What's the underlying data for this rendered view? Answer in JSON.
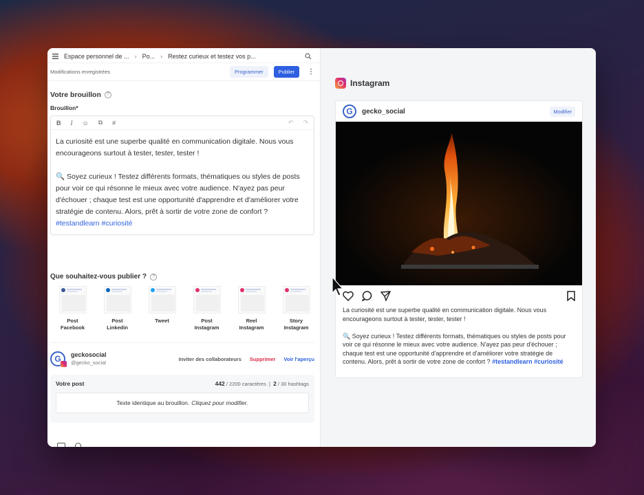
{
  "topbar": {
    "menu_icon": "hamburger-icon",
    "crumb1": "Espace personnel de ...",
    "crumb2": "Po...",
    "crumb3": "Restez curieux et testez vos p...",
    "search_icon": "search-icon"
  },
  "status": {
    "saved": "Modifications enregistrées",
    "schedule": "Programmer",
    "publish": "Publier"
  },
  "draft": {
    "title": "Votre brouillon",
    "label": "Brouillon*",
    "text_1": "La curiosité est une superbe qualité en communication digitale. Nous vous encourageons surtout à tester, tester, tester !",
    "text_2": "🔍 Soyez curieux ! Testez différents formats, thématiques ou styles de posts pour voir ce qui résonne le mieux avec votre audience. N'ayez pas peur d'échouer ; chaque test est une opportunité d'apprendre et d'améliorer votre stratégie de contenu. Alors, prêt à sortir de votre zone de confort ?",
    "tags": "#testandlearn #curiosité"
  },
  "publish_types": {
    "title": "Que souhaitez-vous publier ?",
    "items": [
      {
        "line1": "Post",
        "line2": "Facebook",
        "color": "#3b5998"
      },
      {
        "line1": "Post",
        "line2": "Linkedin",
        "color": "#0a66c2"
      },
      {
        "line1": "Tweet",
        "line2": "",
        "color": "#1da1f2"
      },
      {
        "line1": "Post",
        "line2": "Instagram",
        "color": "#e1306c"
      },
      {
        "line1": "Reel",
        "line2": "Instagram",
        "color": "#e1306c"
      },
      {
        "line1": "Story",
        "line2": "Instagram",
        "color": "#e1306c"
      }
    ]
  },
  "account": {
    "name": "geckosocial",
    "handle": "@gecko_social",
    "invite": "Inviter des collaborateurs",
    "delete": "Supprimer",
    "preview": "Voir l'aperçu"
  },
  "post": {
    "title": "Votre post",
    "chars": "442",
    "chars_total": "/ 2200 caractères",
    "hashtags": "2",
    "hashtags_total": "/ 30 hashtags",
    "identical": "Texte identique au brouillon.",
    "click": "Cliquez pour modifier."
  },
  "preview": {
    "network": "Instagram",
    "username": "gecko_social",
    "edit": "Modifier",
    "caption_1": "La curiosité est une superbe qualité en communication digitale. Nous vous encourageons surtout à tester, tester, tester !",
    "caption_2": "🔍 Soyez curieux ! Testez différents formats, thématiques ou styles de posts pour voir ce qui résonne le mieux avec votre audience. N'ayez pas peur d'échouer ; chaque test est une opportunité d'apprendre et d'améliorer votre stratégie de contenu. Alors, prêt à sortir de votre zone de confort ?",
    "tags": "#testandlearn #curiosité"
  }
}
